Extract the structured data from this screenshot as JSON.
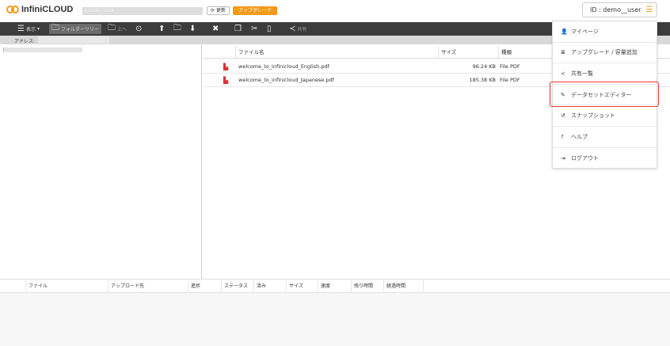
{
  "header": {
    "logo": "InfiniCLOUD",
    "storage": "0.00GB / 20GB",
    "refresh_label": "更新",
    "upgrade_label": "アップグレード",
    "user_id": "ID : demo__user",
    "accent": "#f39a1a"
  },
  "toolbar": {
    "view": "表示",
    "folder_tree": "フォルダーツリー",
    "up": "上へ",
    "share": "共有"
  },
  "address": {
    "label": "アドレス:"
  },
  "files": {
    "columns": [
      "ファイル名",
      "サイズ",
      "種類"
    ],
    "rows": [
      {
        "name": "welcome_to_infinicloud_English.pdf",
        "size": "96.24 KB",
        "type": "File PDF"
      },
      {
        "name": "welcome_to_infinicloud_Japanese.pdf",
        "size": "185.38 KB",
        "type": "File PDF"
      }
    ]
  },
  "uploads": {
    "columns": [
      "ファイル",
      "アップロード先",
      "進捗",
      "ステータス",
      "済み",
      "サイズ",
      "速度",
      "残り時間",
      "経過時間"
    ]
  },
  "menu": {
    "items": [
      {
        "label": "マイページ",
        "icon": "user-icon"
      },
      {
        "label": "アップグレード / 容量追加",
        "icon": "database-icon"
      },
      {
        "label": "共有一覧",
        "icon": "share-icon"
      },
      {
        "label": "データセットエディター",
        "icon": "edit-icon"
      },
      {
        "label": "スナップショット",
        "icon": "history-icon"
      },
      {
        "label": "ヘルプ",
        "icon": "help-icon"
      },
      {
        "label": "ログアウト",
        "icon": "logout-icon"
      }
    ],
    "highlighted": "データセットエディター",
    "highlight_color": "#e53935"
  }
}
